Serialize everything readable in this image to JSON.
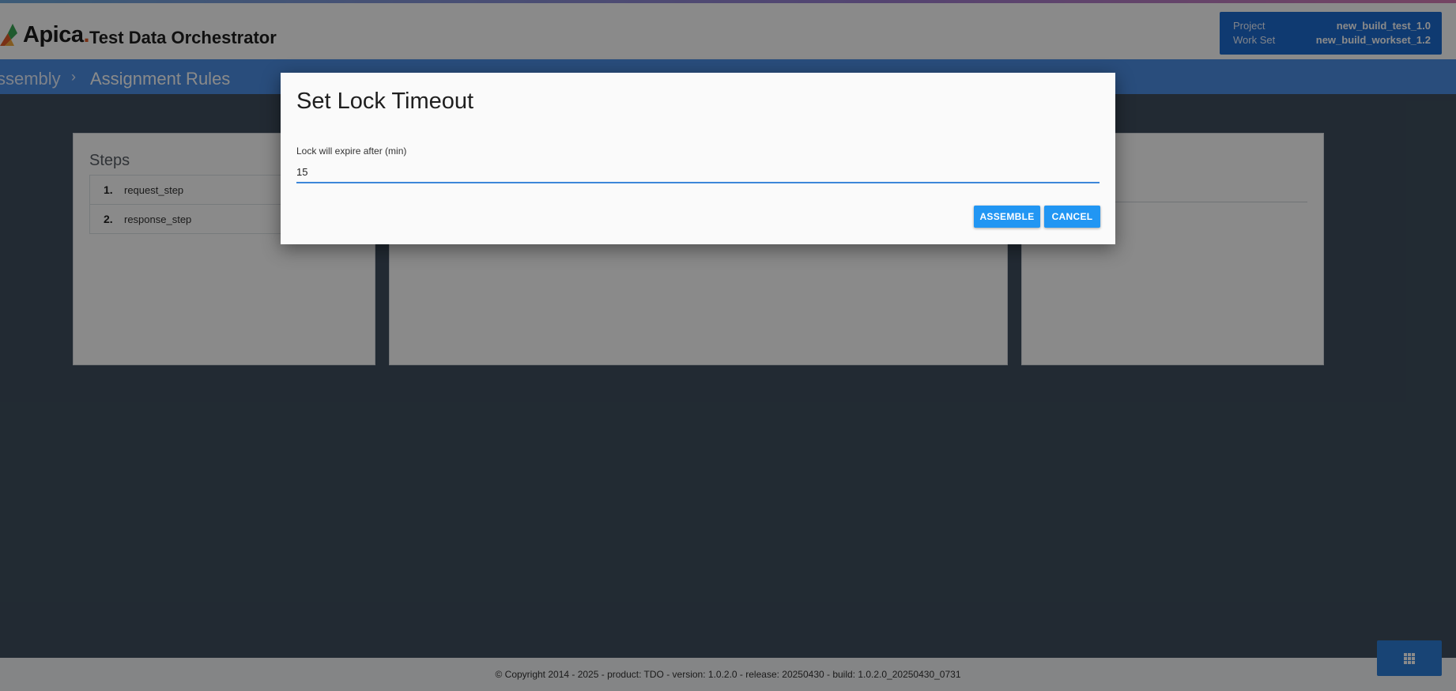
{
  "header": {
    "logo_text": "Apica",
    "logo_dot": ".",
    "product_title": "Test Data Orchestrator",
    "project_label": "Project",
    "project_value": "new_build_test_1.0",
    "workset_label": "Work Set",
    "workset_value": "new_build_workset_1.2"
  },
  "breadcrumb": {
    "items": [
      "ssembly",
      "Assignment Rules"
    ],
    "separator": "›"
  },
  "steps_panel": {
    "title": "Steps",
    "steps": [
      {
        "num": "1.",
        "name": "request_step"
      },
      {
        "num": "2.",
        "name": "response_step"
      }
    ]
  },
  "dialog": {
    "title": "Set Lock Timeout",
    "field_label": "Lock will expire after (min)",
    "field_value": "15",
    "assemble_label": "ASSEMBLE",
    "cancel_label": "CANCEL"
  },
  "footer": {
    "text": "© Copyright 2014 - 2025 - product: TDO - version: 1.0.2.0 - release: 20250430 - build: 1.0.2.0_20250430_0731"
  },
  "colors": {
    "breadcrumb_bar": "#4c8fe5",
    "project_box": "#1d6bd1",
    "button": "#2196f3",
    "input_underline": "#3d87d9",
    "page_background": "#3f4f5e"
  },
  "icons": {
    "logo": "apica-logo-icon",
    "grid": "grid-icon"
  }
}
